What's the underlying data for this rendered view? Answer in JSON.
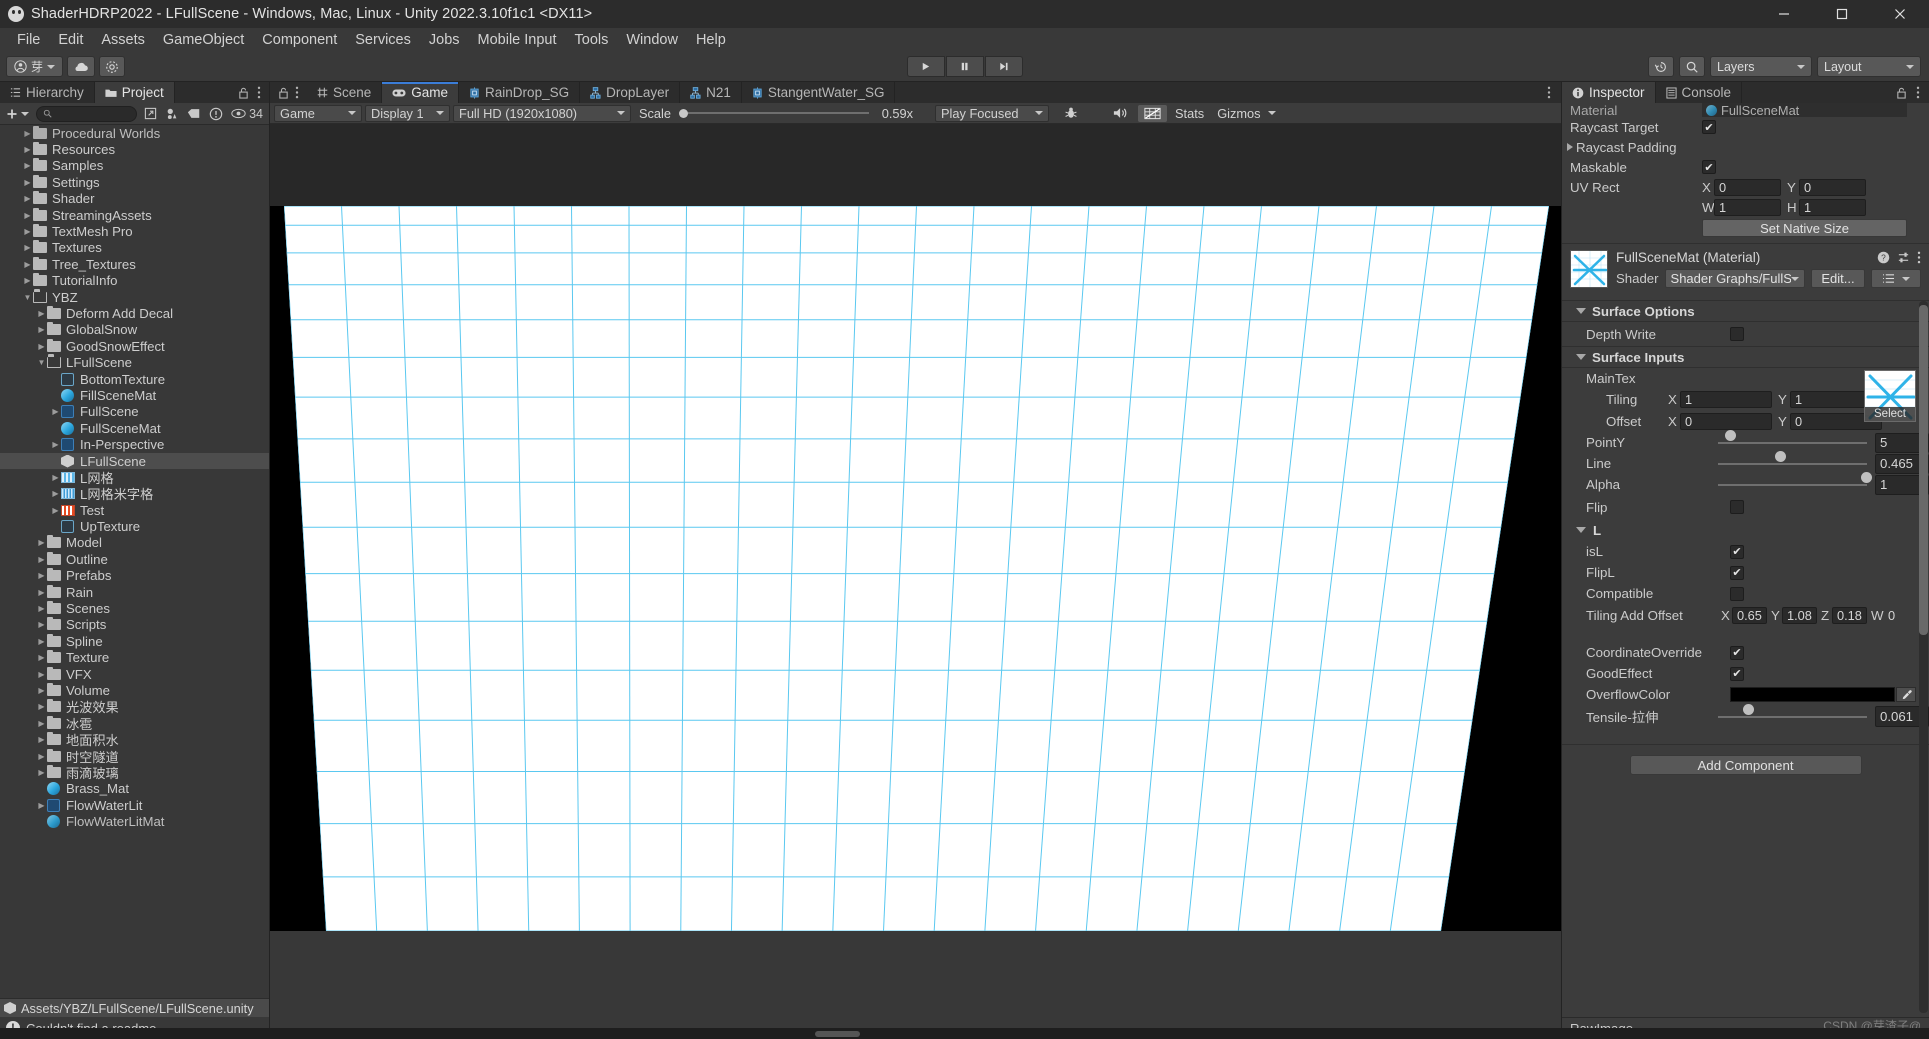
{
  "window": {
    "title": "ShaderHDRP2022 - LFullScene - Windows, Mac, Linux - Unity 2022.3.10f1c1 <DX11>",
    "app_icon": "unity-icon",
    "minimize": "minimize-icon",
    "maximize": "maximize-icon",
    "close": "close-icon"
  },
  "menubar": {
    "items": [
      "File",
      "Edit",
      "Assets",
      "GameObject",
      "Component",
      "Services",
      "Jobs",
      "Mobile Input",
      "Tools",
      "Window",
      "Help"
    ]
  },
  "toolbar": {
    "account_icon": "account-icon",
    "account_label": "芽",
    "cloud_icon": "cloud-icon",
    "settings_icon": "gear-icon",
    "play_icon": "play-icon",
    "pause_icon": "pause-icon",
    "step_icon": "step-icon",
    "history_icon": "history-icon",
    "search_icon": "search-icon",
    "layers_label": "Layers",
    "layout_label": "Layout"
  },
  "project_panel": {
    "tabs": [
      {
        "label": "Hierarchy",
        "icon": "hierarchy-icon",
        "active": false
      },
      {
        "label": "Project",
        "icon": "folder-icon",
        "active": true
      }
    ],
    "lock_icon": "lock-icon",
    "menu_icon": "kebab-menu-icon",
    "toolbar": {
      "create_label": "+",
      "search_placeholder": "",
      "search_value": "",
      "search_icon": "search-icon",
      "save_search_icon": "save-search-icon",
      "avatar_filter_icon": "avatar-filter-icon",
      "label_filter_icon": "label-filter-icon",
      "warning_filter_icon": "warning-filter-icon",
      "count_icon": "eye-icon",
      "count_label": "34"
    },
    "tree": [
      {
        "label": "Procedural Worlds",
        "depth": 1,
        "icon": "folder",
        "arrow": "right",
        "clipped": true
      },
      {
        "label": "Resources",
        "depth": 1,
        "icon": "folder",
        "arrow": "right"
      },
      {
        "label": "Samples",
        "depth": 1,
        "icon": "folder",
        "arrow": "right"
      },
      {
        "label": "Settings",
        "depth": 1,
        "icon": "folder",
        "arrow": "right"
      },
      {
        "label": "Shader",
        "depth": 1,
        "icon": "folder",
        "arrow": "right"
      },
      {
        "label": "StreamingAssets",
        "depth": 1,
        "icon": "folder",
        "arrow": "right"
      },
      {
        "label": "TextMesh Pro",
        "depth": 1,
        "icon": "folder",
        "arrow": "right"
      },
      {
        "label": "Textures",
        "depth": 1,
        "icon": "folder",
        "arrow": "right"
      },
      {
        "label": "Tree_Textures",
        "depth": 1,
        "icon": "folder",
        "arrow": "right"
      },
      {
        "label": "TutorialInfo",
        "depth": 1,
        "icon": "folder",
        "arrow": "right"
      },
      {
        "label": "YBZ",
        "depth": 1,
        "icon": "folder-open",
        "arrow": "down"
      },
      {
        "label": "Deform Add Decal",
        "depth": 2,
        "icon": "folder",
        "arrow": "right"
      },
      {
        "label": "GlobalSnow",
        "depth": 2,
        "icon": "folder",
        "arrow": "right"
      },
      {
        "label": "GoodSnowEffect",
        "depth": 2,
        "icon": "folder",
        "arrow": "right"
      },
      {
        "label": "LFullScene",
        "depth": 2,
        "icon": "folder-open",
        "arrow": "down"
      },
      {
        "label": "BottomTexture",
        "depth": 3,
        "icon": "texture",
        "arrow": "none"
      },
      {
        "label": "FillSceneMat",
        "depth": 3,
        "icon": "material",
        "arrow": "none"
      },
      {
        "label": "FullScene",
        "depth": 3,
        "icon": "shadergraph",
        "arrow": "right"
      },
      {
        "label": "FullSceneMat",
        "depth": 3,
        "icon": "material",
        "arrow": "none"
      },
      {
        "label": "In-Perspective",
        "depth": 3,
        "icon": "shadergraph",
        "arrow": "right"
      },
      {
        "label": "LFullScene",
        "depth": 3,
        "icon": "unity",
        "arrow": "none",
        "selected": true
      },
      {
        "label": "L网格",
        "depth": 3,
        "icon": "stripe",
        "arrow": "right"
      },
      {
        "label": "L网格米字格",
        "depth": 3,
        "icon": "stripe-mix",
        "arrow": "right"
      },
      {
        "label": "Test",
        "depth": 3,
        "icon": "stripe-red",
        "arrow": "right"
      },
      {
        "label": "UpTexture",
        "depth": 3,
        "icon": "texture",
        "arrow": "none"
      },
      {
        "label": "Model",
        "depth": 2,
        "icon": "folder",
        "arrow": "right"
      },
      {
        "label": "Outline",
        "depth": 2,
        "icon": "folder",
        "arrow": "right"
      },
      {
        "label": "Prefabs",
        "depth": 2,
        "icon": "folder",
        "arrow": "right"
      },
      {
        "label": "Rain",
        "depth": 2,
        "icon": "folder",
        "arrow": "right"
      },
      {
        "label": "Scenes",
        "depth": 2,
        "icon": "folder",
        "arrow": "right"
      },
      {
        "label": "Scripts",
        "depth": 2,
        "icon": "folder",
        "arrow": "right"
      },
      {
        "label": "Spline",
        "depth": 2,
        "icon": "folder",
        "arrow": "right"
      },
      {
        "label": "Texture",
        "depth": 2,
        "icon": "folder",
        "arrow": "right"
      },
      {
        "label": "VFX",
        "depth": 2,
        "icon": "folder",
        "arrow": "right"
      },
      {
        "label": "Volume",
        "depth": 2,
        "icon": "folder",
        "arrow": "right"
      },
      {
        "label": "光波效果",
        "depth": 2,
        "icon": "folder",
        "arrow": "right"
      },
      {
        "label": "冰雹",
        "depth": 2,
        "icon": "folder",
        "arrow": "right"
      },
      {
        "label": "地面积水",
        "depth": 2,
        "icon": "folder",
        "arrow": "right"
      },
      {
        "label": "时空隧道",
        "depth": 2,
        "icon": "folder",
        "arrow": "right"
      },
      {
        "label": "雨滴玻璃",
        "depth": 2,
        "icon": "folder",
        "arrow": "right"
      },
      {
        "label": "Brass_Mat",
        "depth": 2,
        "icon": "material",
        "arrow": "none"
      },
      {
        "label": "FlowWaterLit",
        "depth": 2,
        "icon": "shadergraph",
        "arrow": "right"
      },
      {
        "label": "FlowWaterLitMat",
        "depth": 2,
        "icon": "material",
        "arrow": "none",
        "clipped": true
      }
    ],
    "selected_path": "Assets/YBZ/LFullScene/LFullScene.unity",
    "status_message": "Couldn't find a readme"
  },
  "game_panel": {
    "lock_icon": "lock-icon",
    "menu_icon": "kebab-menu-icon",
    "tabs": [
      {
        "label": "Scene",
        "icon": "scene-icon",
        "active": false
      },
      {
        "label": "Game",
        "icon": "game-icon",
        "active": true
      },
      {
        "label": "RainDrop_SG",
        "icon": "shadergraph-icon",
        "active": false
      },
      {
        "label": "DropLayer",
        "icon": "subgraph-icon",
        "active": false
      },
      {
        "label": "N21",
        "icon": "subgraph-icon",
        "active": false
      },
      {
        "label": "StangentWater_SG",
        "icon": "shadergraph-icon",
        "active": false
      }
    ],
    "toolbar": {
      "target_label": "Game",
      "display_label": "Display 1",
      "resolution_label": "Full HD (1920x1080)",
      "scale_label": "Scale",
      "scale_value": "0.59x",
      "play_focus_label": "Play Focused",
      "mute_icon": "mute-audio-icon",
      "bug_icon": "bug-icon",
      "gizmo_render_icon": "gizmo-render-icon",
      "stats_label": "Stats",
      "gizmos_label": "Gizmos"
    }
  },
  "inspector": {
    "tabs": [
      {
        "label": "Inspector",
        "icon": "info-icon",
        "active": true
      },
      {
        "label": "Console",
        "icon": "console-icon",
        "active": false
      }
    ],
    "lock_icon": "lock-icon",
    "menu_icon": "kebab-menu-icon",
    "rawimage": {
      "material_label": "Material",
      "material_value": "FullSceneMat",
      "raycast_target_label": "Raycast Target",
      "raycast_target_checked": true,
      "raycast_padding_label": "Raycast Padding",
      "maskable_label": "Maskable",
      "maskable_checked": true,
      "uv_rect_label": "UV Rect",
      "uv_rect": {
        "x_label": "X",
        "x": "0",
        "y_label": "Y",
        "y": "0",
        "w_label": "W",
        "w": "1",
        "h_label": "H",
        "h": "1"
      },
      "set_native_size_label": "Set Native Size"
    },
    "material": {
      "title": "FullSceneMat (Material)",
      "help_icon": "help-icon",
      "preset_icon": "preset-icon",
      "menu_icon": "kebab-menu-icon",
      "shader_label": "Shader",
      "shader_value": "Shader Graphs/FullSc",
      "edit_label": "Edit...",
      "list_icon": "list-icon"
    },
    "surface_options": {
      "header": "Surface Options",
      "depth_write_label": "Depth Write",
      "depth_write_checked": false
    },
    "surface_inputs": {
      "header": "Surface Inputs",
      "maintex_label": "MainTex",
      "select_label": "Select",
      "tiling_label": "Tiling",
      "tiling": {
        "x_label": "X",
        "x": "1",
        "y_label": "Y",
        "y": "1"
      },
      "offset_label": "Offset",
      "offset": {
        "x_label": "X",
        "x": "0",
        "y_label": "Y",
        "y": "0"
      },
      "sliders": [
        {
          "label": "PointY",
          "value": "5",
          "pct": 5
        },
        {
          "label": "Line",
          "value": "0.465",
          "pct": 38
        },
        {
          "label": "Alpha",
          "value": "1",
          "pct": 96
        }
      ],
      "flip_label": "Flip",
      "flip_checked": false
    },
    "l_section": {
      "header": "L",
      "isl_label": "isL",
      "isl_checked": true,
      "flipl_label": "FlipL",
      "flipl_checked": true,
      "compatible_label": "Compatible",
      "compatible_checked": false,
      "tiling_add_offset_label": "Tiling Add Offset",
      "tiling_add_offset": {
        "x_label": "X",
        "x": "0.65",
        "y_label": "Y",
        "y": "1.08",
        "z_label": "Z",
        "z": "0.18",
        "w_label": "W",
        "w": "0"
      },
      "coordinate_override_label": "CoordinateOverride",
      "coordinate_override_checked": true,
      "good_effect_label": "GoodEffect",
      "good_effect_checked": true,
      "overflow_color_label": "OverflowColor",
      "overflow_color_value": "#000000",
      "eyedropper_icon": "eyedropper-icon",
      "tensile_label": "Tensile-拉伸",
      "tensile_value": "0.061",
      "tensile_pct": 17
    },
    "add_component_label": "Add Component",
    "footer_label": "RawImage"
  },
  "watermark": "CSDN @芽渣子@",
  "colors": {
    "accent_blue": "#3b7dd8",
    "panel_bg": "#383838",
    "panel_dark": "#2c2c2c",
    "grid_cyan": "#5ac8f0",
    "selection": "#4d4d4d"
  }
}
